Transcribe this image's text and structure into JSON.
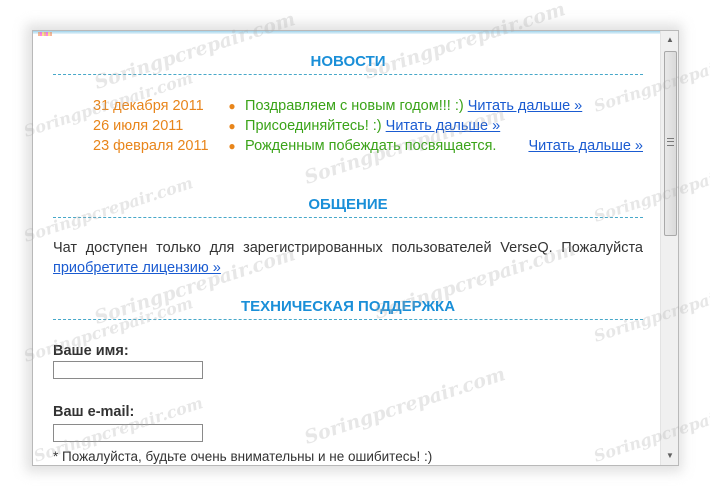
{
  "watermark": "Soringpcrepair.com",
  "news": {
    "title": "НОВОСТИ",
    "items": [
      {
        "date": "31 декабря 2011",
        "text": "Поздравляем с новым годом!!! :)",
        "link": "Читать дальше »"
      },
      {
        "date": "26 июля 2011",
        "text": "Присоединяйтесь! :)",
        "link": "Читать дальше »"
      },
      {
        "date": "23 февраля 2011",
        "text": "Рожденным побеждать посвящается.",
        "link": "Читать дальше »"
      }
    ]
  },
  "chat": {
    "title": "ОБЩЕНИЕ",
    "text": "Чат доступен только для зарегистрированных пользователей VerseQ. Пожалуйста",
    "link": "приобретите лицензию »"
  },
  "support": {
    "title": "ТЕХНИЧЕСКАЯ ПОДДЕРЖКА",
    "name_label": "Ваше имя:",
    "name_value": "",
    "email_label": "Ваш e-mail:",
    "email_value": "",
    "note": "* Пожалуйста, будьте очень внимательны и не ошибитесь! :)"
  },
  "scrollbar": {
    "up_icon": "arrow-up-icon",
    "down_icon": "arrow-down-icon"
  }
}
